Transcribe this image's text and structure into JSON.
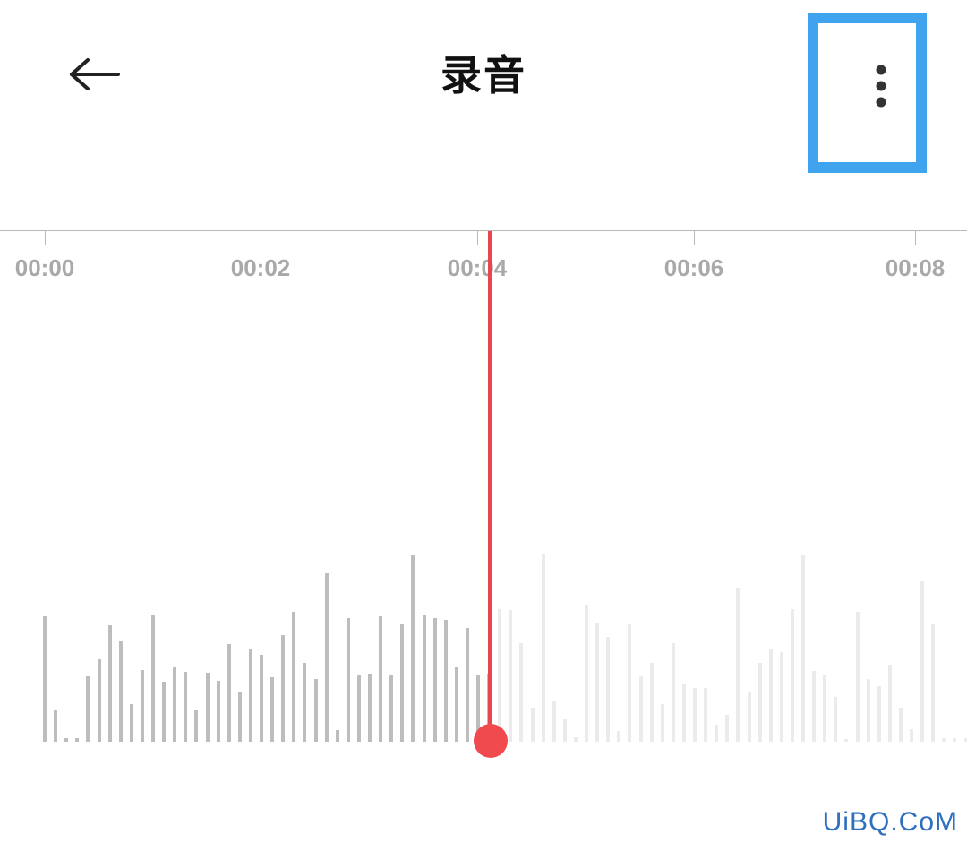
{
  "header": {
    "title": "录音",
    "back_icon": "arrow-left-icon",
    "more_icon": "more-vertical-icon",
    "highlight_color": "#3fa3ee"
  },
  "timeline": {
    "ticks": [
      "00:00",
      "00:02",
      "00:04",
      "00:06",
      "00:08"
    ]
  },
  "waveform": {
    "playhead_color": "#e8474f",
    "played_color": "#bdbdbd",
    "unplayed_color": "#ebebeb",
    "playhead_position": 0.508
  },
  "watermark": "UiBQ.CoM"
}
